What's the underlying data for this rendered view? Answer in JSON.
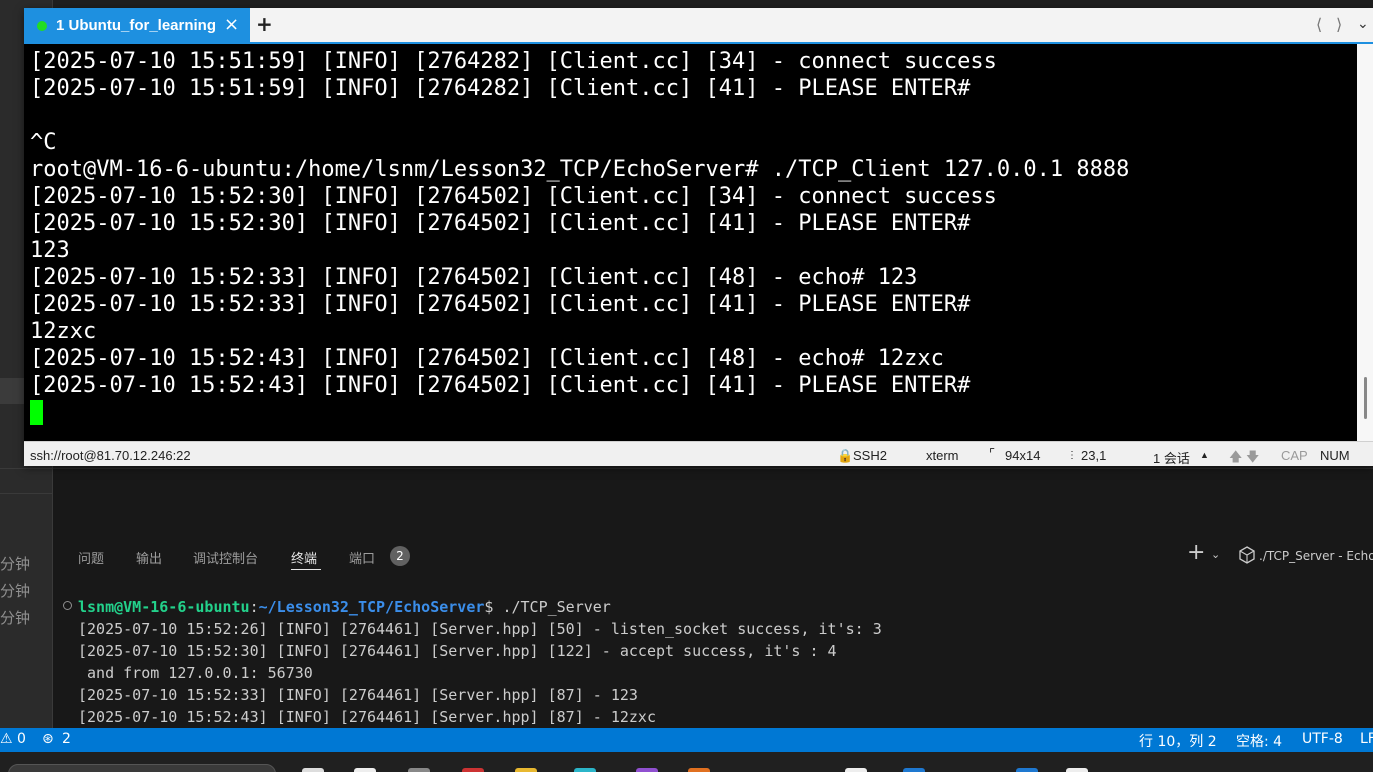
{
  "vscode": {
    "top_fragment": "echo",
    "minute_labels": [
      "分钟",
      "分钟",
      "分钟"
    ],
    "panel": {
      "tabs": {
        "problems": "问题",
        "output": "输出",
        "debug_console": "调试控制台",
        "terminal": "终端",
        "ports": "端口"
      },
      "ports_count": "2",
      "add_terminal": "+",
      "terminal_instance_label": "./TCP_Server - Echo"
    },
    "terminal": {
      "prompt_user": "lsnm@VM-16-6-ubuntu",
      "prompt_colon": ":",
      "prompt_path": "~/Lesson32_TCP/EchoServer",
      "prompt_cmd": "$ ./TCP_Server",
      "lines": [
        "[2025-07-10 15:52:26] [INFO] [2764461] [Server.hpp] [50] - listen_socket success, it's: 3",
        "[2025-07-10 15:52:30] [INFO] [2764461] [Server.hpp] [122] - accept success, it's : 4",
        " and from 127.0.0.1: 56730",
        "[2025-07-10 15:52:33] [INFO] [2764461] [Server.hpp] [87] - 123",
        "[2025-07-10 15:52:43] [INFO] [2764461] [Server.hpp] [87] - 12zxc"
      ]
    },
    "statusbar": {
      "warnings": "⚠ 0",
      "ports": "2",
      "cursor_pos": "行 10，列 2",
      "indent": "空格: 4",
      "encoding": "UTF-8",
      "eol": "LF"
    }
  },
  "ssh": {
    "tab_label": "1 Ubuntu_for_learning",
    "tab_close": "×",
    "new_tab": "+",
    "terminal_lines": [
      "[2025-07-10 15:51:59] [INFO] [2764282] [Client.cc] [34] - connect success",
      "[2025-07-10 15:51:59] [INFO] [2764282] [Client.cc] [41] - PLEASE ENTER#",
      "",
      "^C",
      "root@VM-16-6-ubuntu:/home/lsnm/Lesson32_TCP/EchoServer# ./TCP_Client 127.0.0.1 8888",
      "[2025-07-10 15:52:30] [INFO] [2764502] [Client.cc] [34] - connect success",
      "[2025-07-10 15:52:30] [INFO] [2764502] [Client.cc] [41] - PLEASE ENTER#",
      "123",
      "[2025-07-10 15:52:33] [INFO] [2764502] [Client.cc] [48] - echo# 123",
      "[2025-07-10 15:52:33] [INFO] [2764502] [Client.cc] [41] - PLEASE ENTER#",
      "12zxc",
      "[2025-07-10 15:52:43] [INFO] [2764502] [Client.cc] [48] - echo# 12zxc",
      "[2025-07-10 15:52:43] [INFO] [2764502] [Client.cc] [41] - PLEASE ENTER#"
    ],
    "status": {
      "address": "ssh://root@81.70.12.246:22",
      "protocol": "SSH2",
      "term_type": "xterm",
      "size": "94x14",
      "position": "23,1",
      "sessions": "1 会话",
      "cap": "CAP",
      "num": "NUM"
    }
  },
  "colors": {
    "tab_blue": "#1e90e0",
    "cursor_green": "#00ff00",
    "status_blue": "#0078d4",
    "prompt_green": "#23d18b",
    "prompt_blue": "#3b8eea"
  }
}
